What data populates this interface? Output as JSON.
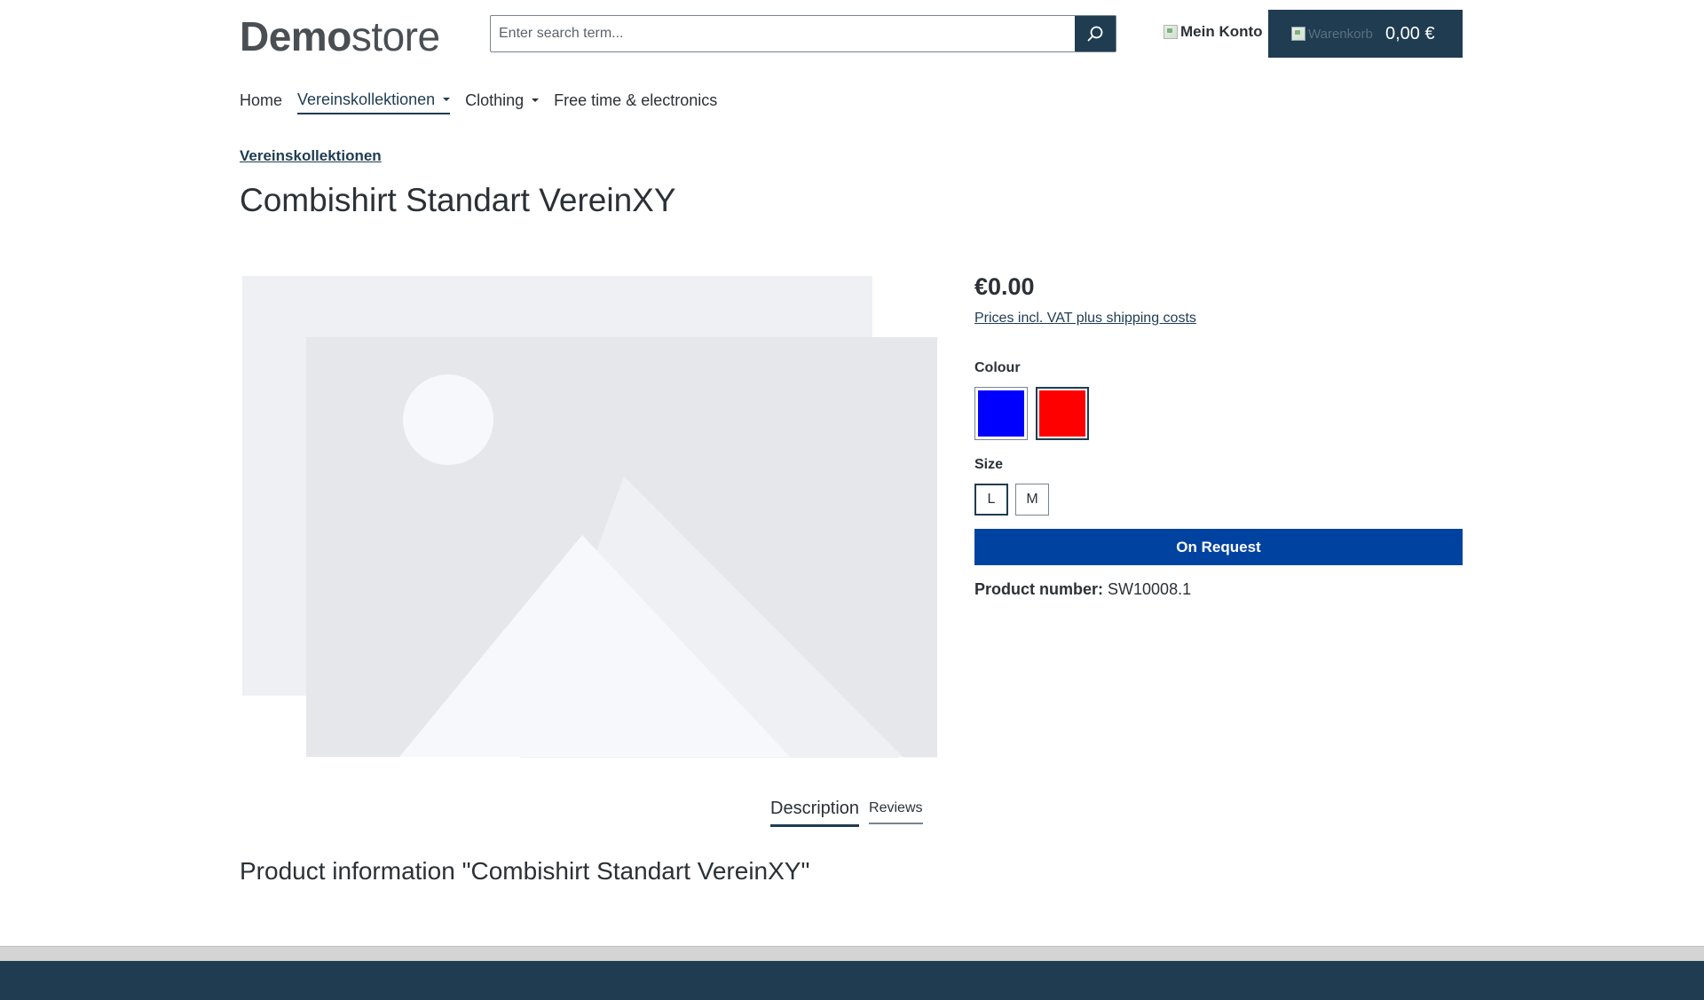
{
  "header": {
    "logo_bold": "Demo",
    "logo_light": "store",
    "search": {
      "placeholder": "Enter search term..."
    },
    "account_label": "Mein Konto",
    "cart": {
      "image_alt": "Warenkorb",
      "total": "0,00 €"
    }
  },
  "nav": {
    "items": [
      {
        "label": "Home",
        "dropdown": false,
        "active": false
      },
      {
        "label": "Vereinskollektionen",
        "dropdown": true,
        "active": true
      },
      {
        "label": "Clothing",
        "dropdown": true,
        "active": false
      },
      {
        "label": "Free time & electronics",
        "dropdown": false,
        "active": false
      }
    ]
  },
  "breadcrumb": "Vereinskollektionen",
  "product": {
    "title": "Combishirt Standart VereinXY",
    "price": "€0.00",
    "vat_link": "Prices incl. VAT plus shipping costs",
    "colour_label": "Colour",
    "colours": [
      {
        "name": "blue",
        "hex": "#0000ff",
        "selected": false
      },
      {
        "name": "red",
        "hex": "#ff0000",
        "selected": true
      }
    ],
    "size_label": "Size",
    "sizes": [
      {
        "label": "L",
        "selected": true
      },
      {
        "label": "M",
        "selected": false
      }
    ],
    "request_button": "On Request",
    "product_number_label": "Product number:",
    "product_number": "SW10008.1"
  },
  "tabs": {
    "description": "Description",
    "reviews": "Reviews"
  },
  "product_info_title": "Product information \"Combishirt Standart VereinXY\"",
  "colors": {
    "primary": "#1f3c51",
    "cta": "#0042a0",
    "text": "#2b3136"
  }
}
